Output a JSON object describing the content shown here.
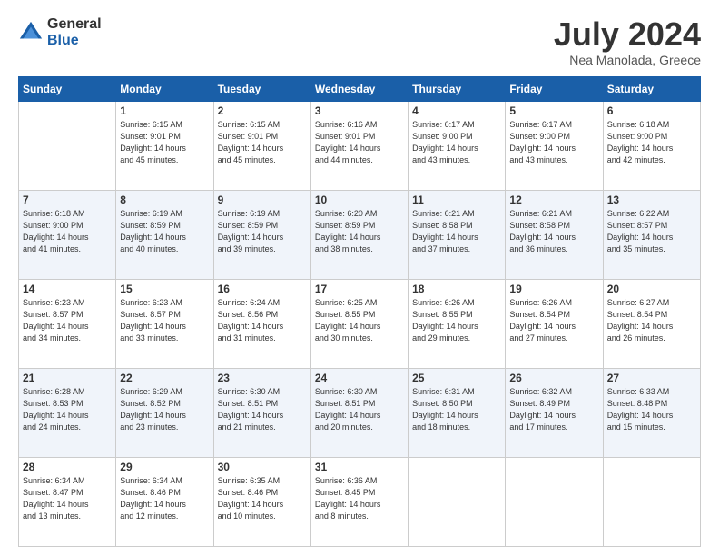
{
  "logo": {
    "general": "General",
    "blue": "Blue"
  },
  "header": {
    "month": "July 2024",
    "location": "Nea Manolada, Greece"
  },
  "weekdays": [
    "Sunday",
    "Monday",
    "Tuesday",
    "Wednesday",
    "Thursday",
    "Friday",
    "Saturday"
  ],
  "weeks": [
    [
      {
        "day": "",
        "info": ""
      },
      {
        "day": "1",
        "info": "Sunrise: 6:15 AM\nSunset: 9:01 PM\nDaylight: 14 hours\nand 45 minutes."
      },
      {
        "day": "2",
        "info": "Sunrise: 6:15 AM\nSunset: 9:01 PM\nDaylight: 14 hours\nand 45 minutes."
      },
      {
        "day": "3",
        "info": "Sunrise: 6:16 AM\nSunset: 9:01 PM\nDaylight: 14 hours\nand 44 minutes."
      },
      {
        "day": "4",
        "info": "Sunrise: 6:17 AM\nSunset: 9:00 PM\nDaylight: 14 hours\nand 43 minutes."
      },
      {
        "day": "5",
        "info": "Sunrise: 6:17 AM\nSunset: 9:00 PM\nDaylight: 14 hours\nand 43 minutes."
      },
      {
        "day": "6",
        "info": "Sunrise: 6:18 AM\nSunset: 9:00 PM\nDaylight: 14 hours\nand 42 minutes."
      }
    ],
    [
      {
        "day": "7",
        "info": "Sunrise: 6:18 AM\nSunset: 9:00 PM\nDaylight: 14 hours\nand 41 minutes."
      },
      {
        "day": "8",
        "info": "Sunrise: 6:19 AM\nSunset: 8:59 PM\nDaylight: 14 hours\nand 40 minutes."
      },
      {
        "day": "9",
        "info": "Sunrise: 6:19 AM\nSunset: 8:59 PM\nDaylight: 14 hours\nand 39 minutes."
      },
      {
        "day": "10",
        "info": "Sunrise: 6:20 AM\nSunset: 8:59 PM\nDaylight: 14 hours\nand 38 minutes."
      },
      {
        "day": "11",
        "info": "Sunrise: 6:21 AM\nSunset: 8:58 PM\nDaylight: 14 hours\nand 37 minutes."
      },
      {
        "day": "12",
        "info": "Sunrise: 6:21 AM\nSunset: 8:58 PM\nDaylight: 14 hours\nand 36 minutes."
      },
      {
        "day": "13",
        "info": "Sunrise: 6:22 AM\nSunset: 8:57 PM\nDaylight: 14 hours\nand 35 minutes."
      }
    ],
    [
      {
        "day": "14",
        "info": "Sunrise: 6:23 AM\nSunset: 8:57 PM\nDaylight: 14 hours\nand 34 minutes."
      },
      {
        "day": "15",
        "info": "Sunrise: 6:23 AM\nSunset: 8:57 PM\nDaylight: 14 hours\nand 33 minutes."
      },
      {
        "day": "16",
        "info": "Sunrise: 6:24 AM\nSunset: 8:56 PM\nDaylight: 14 hours\nand 31 minutes."
      },
      {
        "day": "17",
        "info": "Sunrise: 6:25 AM\nSunset: 8:55 PM\nDaylight: 14 hours\nand 30 minutes."
      },
      {
        "day": "18",
        "info": "Sunrise: 6:26 AM\nSunset: 8:55 PM\nDaylight: 14 hours\nand 29 minutes."
      },
      {
        "day": "19",
        "info": "Sunrise: 6:26 AM\nSunset: 8:54 PM\nDaylight: 14 hours\nand 27 minutes."
      },
      {
        "day": "20",
        "info": "Sunrise: 6:27 AM\nSunset: 8:54 PM\nDaylight: 14 hours\nand 26 minutes."
      }
    ],
    [
      {
        "day": "21",
        "info": "Sunrise: 6:28 AM\nSunset: 8:53 PM\nDaylight: 14 hours\nand 24 minutes."
      },
      {
        "day": "22",
        "info": "Sunrise: 6:29 AM\nSunset: 8:52 PM\nDaylight: 14 hours\nand 23 minutes."
      },
      {
        "day": "23",
        "info": "Sunrise: 6:30 AM\nSunset: 8:51 PM\nDaylight: 14 hours\nand 21 minutes."
      },
      {
        "day": "24",
        "info": "Sunrise: 6:30 AM\nSunset: 8:51 PM\nDaylight: 14 hours\nand 20 minutes."
      },
      {
        "day": "25",
        "info": "Sunrise: 6:31 AM\nSunset: 8:50 PM\nDaylight: 14 hours\nand 18 minutes."
      },
      {
        "day": "26",
        "info": "Sunrise: 6:32 AM\nSunset: 8:49 PM\nDaylight: 14 hours\nand 17 minutes."
      },
      {
        "day": "27",
        "info": "Sunrise: 6:33 AM\nSunset: 8:48 PM\nDaylight: 14 hours\nand 15 minutes."
      }
    ],
    [
      {
        "day": "28",
        "info": "Sunrise: 6:34 AM\nSunset: 8:47 PM\nDaylight: 14 hours\nand 13 minutes."
      },
      {
        "day": "29",
        "info": "Sunrise: 6:34 AM\nSunset: 8:46 PM\nDaylight: 14 hours\nand 12 minutes."
      },
      {
        "day": "30",
        "info": "Sunrise: 6:35 AM\nSunset: 8:46 PM\nDaylight: 14 hours\nand 10 minutes."
      },
      {
        "day": "31",
        "info": "Sunrise: 6:36 AM\nSunset: 8:45 PM\nDaylight: 14 hours\nand 8 minutes."
      },
      {
        "day": "",
        "info": ""
      },
      {
        "day": "",
        "info": ""
      },
      {
        "day": "",
        "info": ""
      }
    ]
  ]
}
